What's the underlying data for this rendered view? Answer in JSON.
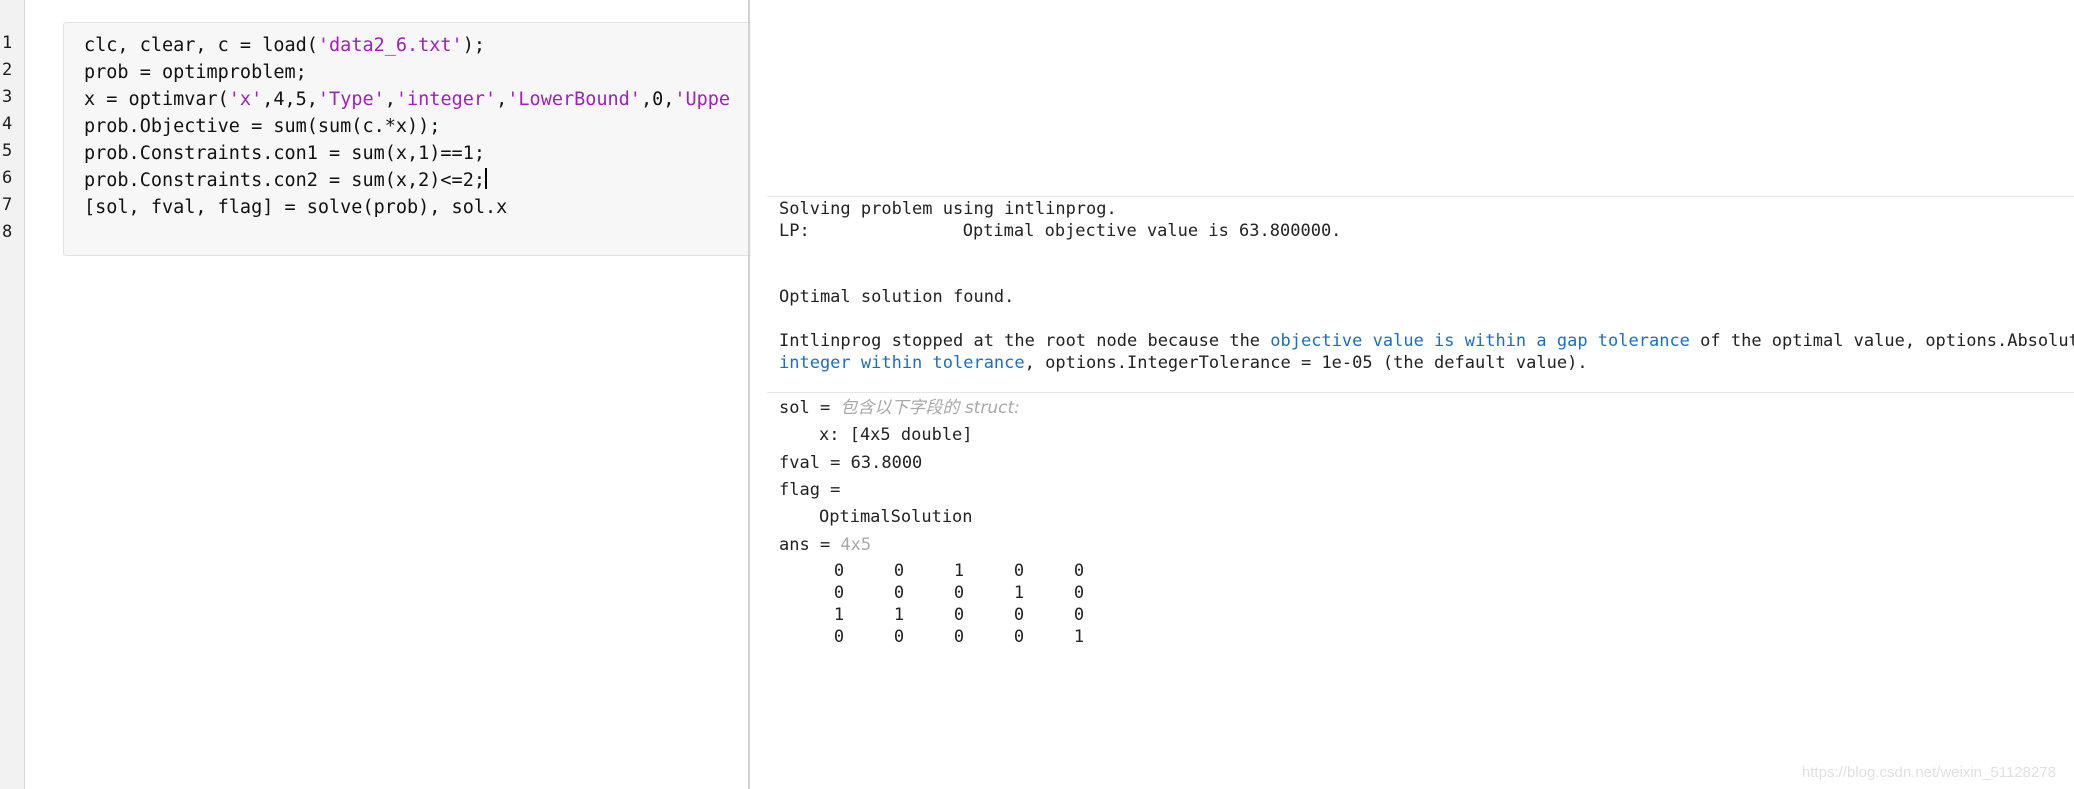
{
  "gutter": {
    "line_numbers": [
      "1",
      "2",
      "3",
      "4",
      "5",
      "6",
      "7",
      "8"
    ]
  },
  "editor": {
    "lines": [
      [
        {
          "t": "clc, clear, c = load(",
          "s": false
        },
        {
          "t": "'data2_6.txt'",
          "s": true
        },
        {
          "t": ");",
          "s": false
        }
      ],
      [
        {
          "t": "prob = optimproblem;",
          "s": false
        }
      ],
      [
        {
          "t": "x = optimvar(",
          "s": false
        },
        {
          "t": "'x'",
          "s": true
        },
        {
          "t": ",4,5,",
          "s": false
        },
        {
          "t": "'Type'",
          "s": true
        },
        {
          "t": ",",
          "s": false
        },
        {
          "t": "'integer'",
          "s": true
        },
        {
          "t": ",",
          "s": false
        },
        {
          "t": "'LowerBound'",
          "s": true
        },
        {
          "t": ",0,",
          "s": false
        },
        {
          "t": "'Uppe",
          "s": true
        }
      ],
      [
        {
          "t": "prob.Objective = sum(sum(c.*x));",
          "s": false
        }
      ],
      [
        {
          "t": "prob.Constraints.con1 = sum(x,1)==1;",
          "s": false
        }
      ],
      [
        {
          "t": "prob.Constraints.con2 = sum(x,2)<=2;",
          "s": false
        }
      ],
      [
        {
          "t": "[sol, fval, flag] = solve(prob), sol.x",
          "s": false
        }
      ],
      []
    ],
    "cursor_line_index": 5
  },
  "output": {
    "solving": "Solving problem using intlinprog.",
    "lp_label": "LP:",
    "lp_text": "Optimal objective value is 63.800000.",
    "optimal_found": "Optimal solution found.",
    "stopped_pre": "Intlinprog stopped at the root node because the ",
    "stopped_link": "objective value is within a gap tolerance",
    "stopped_post": " of the optimal value, options.AbsoluteGa",
    "integer_link": "integer within tolerance",
    "integer_post": ", options.IntegerTolerance = 1e-05 (the default value).",
    "sol_label": "sol = ",
    "sol_desc": "包含以下字段的 struct:",
    "sol_field": "x: [4x5 double]",
    "fval": "fval = 63.8000",
    "flag_label": "flag =",
    "flag_value": "OptimalSolution",
    "ans_label": "ans = ",
    "ans_size": "4x5",
    "matrix": [
      [
        0,
        0,
        1,
        0,
        0
      ],
      [
        0,
        0,
        0,
        1,
        0
      ],
      [
        1,
        1,
        0,
        0,
        0
      ],
      [
        0,
        0,
        0,
        0,
        1
      ]
    ]
  },
  "watermark": "https://blog.csdn.net/weixin_51128278"
}
